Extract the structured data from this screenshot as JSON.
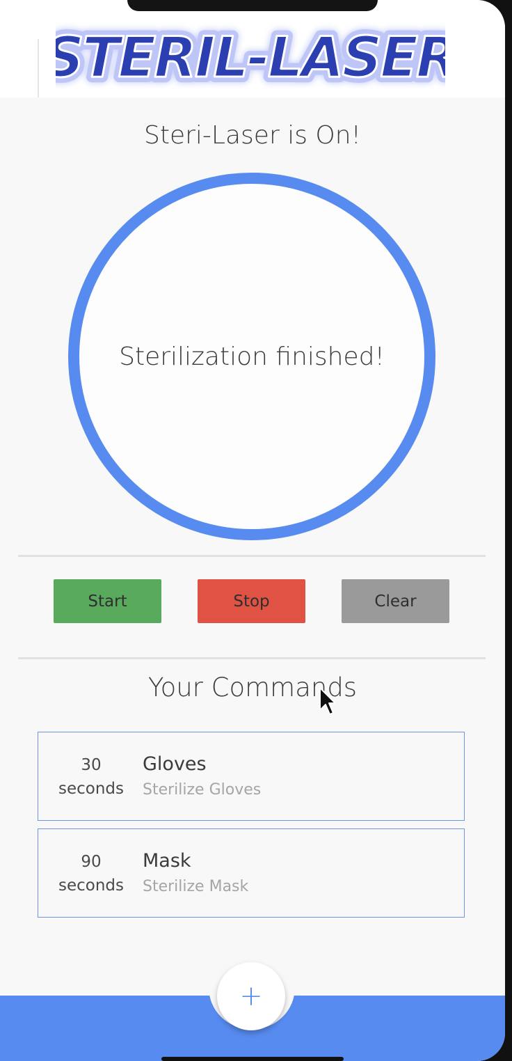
{
  "app": {
    "logo_text": "STERIL-LASER",
    "accent_color": "#578bef"
  },
  "status": {
    "title": "Steri-Laser is On!",
    "ring_message": "Sterilization finished!"
  },
  "controls": {
    "start_label": "Start",
    "stop_label": "Stop",
    "clear_label": "Clear",
    "start_color": "#5aaa5e",
    "stop_color": "#e05344",
    "clear_color": "#9a9a9a"
  },
  "commands": {
    "title": "Your Commands",
    "items": [
      {
        "duration": "30",
        "unit": "seconds",
        "name": "Gloves",
        "description": "Sterilize Gloves"
      },
      {
        "duration": "90",
        "unit": "seconds",
        "name": "Mask",
        "description": "Sterilize Mask"
      }
    ]
  },
  "fab": {
    "label": "+",
    "icon": "plus-icon"
  }
}
